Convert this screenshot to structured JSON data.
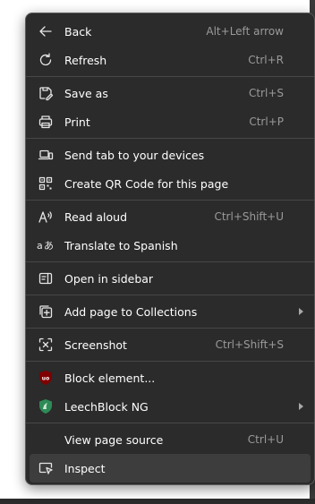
{
  "menu": {
    "items": [
      {
        "label": "Back",
        "shortcut": "Alt+Left arrow",
        "icon": "back-arrow-icon"
      },
      {
        "label": "Refresh",
        "shortcut": "Ctrl+R",
        "icon": "refresh-icon"
      },
      {
        "label": "Save as",
        "shortcut": "Ctrl+S",
        "icon": "save-as-icon"
      },
      {
        "label": "Print",
        "shortcut": "Ctrl+P",
        "icon": "printer-icon"
      },
      {
        "label": "Send tab to your devices",
        "shortcut": "",
        "icon": "devices-icon"
      },
      {
        "label": "Create QR Code for this page",
        "shortcut": "",
        "icon": "qr-code-icon"
      },
      {
        "label": "Read aloud",
        "shortcut": "Ctrl+Shift+U",
        "icon": "read-aloud-icon"
      },
      {
        "label": "Translate to Spanish",
        "shortcut": "",
        "icon": "translate-icon"
      },
      {
        "label": "Open in sidebar",
        "shortcut": "",
        "icon": "sidebar-icon"
      },
      {
        "label": "Add page to Collections",
        "shortcut": "",
        "icon": "collections-icon",
        "submenu": true
      },
      {
        "label": "Screenshot",
        "shortcut": "Ctrl+Shift+S",
        "icon": "screenshot-icon"
      },
      {
        "label": "Block element...",
        "shortcut": "",
        "icon": "ublock-icon"
      },
      {
        "label": "LeechBlock NG",
        "shortcut": "",
        "icon": "leechblock-icon",
        "submenu": true
      },
      {
        "label": "View page source",
        "shortcut": "Ctrl+U",
        "icon": ""
      },
      {
        "label": "Inspect",
        "shortcut": "",
        "icon": "inspect-icon",
        "highlighted": true
      }
    ]
  },
  "colors": {
    "menu_bg": "#2b2b2b",
    "hover_bg": "#3d3d3d",
    "text": "#ffffff",
    "shortcut_text": "#9a9a9a",
    "separator": "#474747",
    "ublock_red": "#800000",
    "leechblock_green": "#2e8b57"
  }
}
